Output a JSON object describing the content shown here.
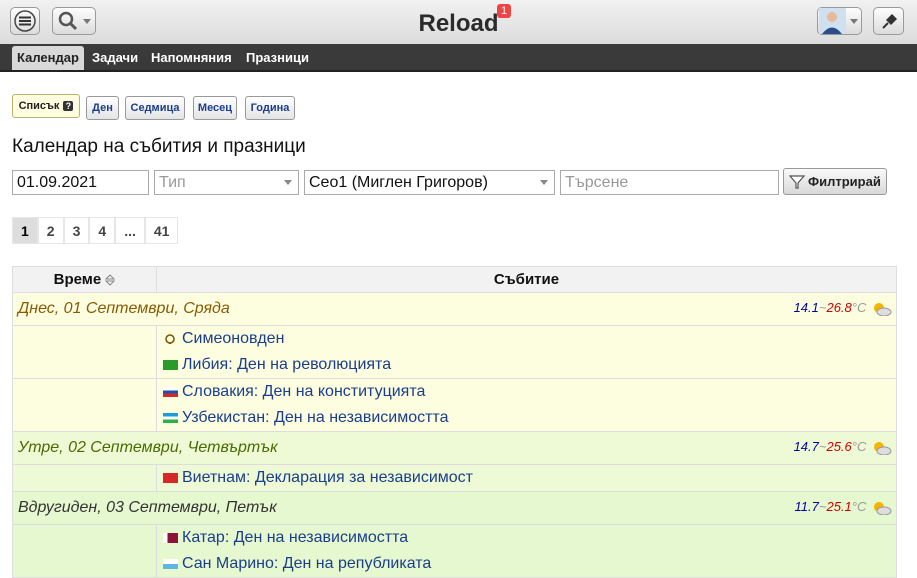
{
  "header": {
    "title": "Reload",
    "badge": "1"
  },
  "tabs": [
    "Календар",
    "Задачи",
    "Напомняния",
    "Празници"
  ],
  "views": {
    "list": "Списък",
    "day": "Ден",
    "week": "Седмица",
    "month": "Месец",
    "year": "Година"
  },
  "page_title": "Календар на събития и празници",
  "filters": {
    "date": "01.09.2021",
    "type_placeholder": "Тип",
    "city": "Сео1 (Миглен Григоров)",
    "search_placeholder": "Търсене",
    "filter_label": "Филтрирай"
  },
  "pager": [
    "1",
    "2",
    "3",
    "4",
    "...",
    "41"
  ],
  "table": {
    "col_time": "Време",
    "col_event": "Събитие",
    "days": [
      {
        "label": "Днес, 01 Септември, Сряда",
        "tlo": "14.1",
        "thi": "26.8",
        "unit": "°C",
        "groups": [
          [
            "Симеоновден",
            "Либия: Ден на революцията"
          ],
          [
            "Словакия: Ден на конституцията",
            "Узбекистан: Ден на независимостта"
          ]
        ]
      },
      {
        "label": "Утре, 02 Септември, Четвъртък",
        "tlo": "14.7",
        "thi": "25.6",
        "unit": "°C",
        "groups": [
          [
            "Виетнам: Декларация за независимост"
          ]
        ]
      },
      {
        "label": "Вдругиден, 03 Септември, Петък",
        "tlo": "11.7",
        "thi": "25.1",
        "unit": "°C",
        "groups": [
          [
            "Катар: Ден на независимостта",
            "Сан Марино: Ден на републиката"
          ]
        ]
      }
    ]
  }
}
